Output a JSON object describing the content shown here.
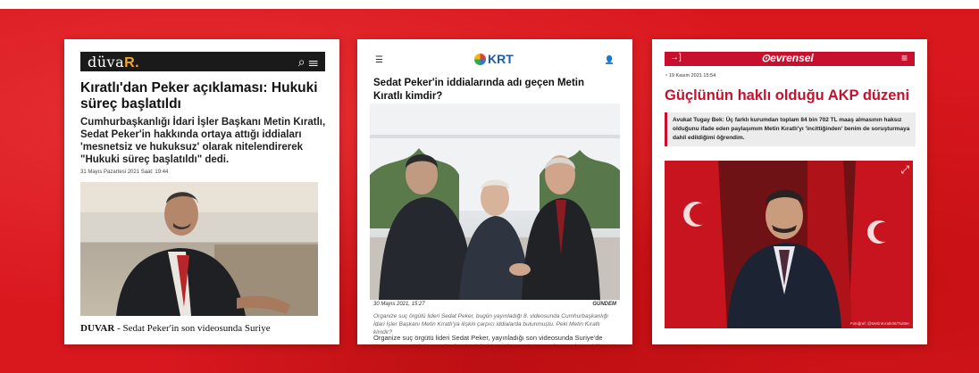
{
  "cards": [
    {
      "logo_main": "düva",
      "logo_accent": "R.",
      "title": "Kıratlı'dan Peker açıklaması: Hukuki süreç başlatıldı",
      "lead": "Cumhurbaşkanlığı İdari İşler Başkanı Metin Kıratlı, Sedat Peker'in hakkında ortaya attığı iddiaları 'mesnetsiz ve hukuksuz' olarak nitelendirerek \"Hukuki süreç başlatıldı\" dedi.",
      "date": "31 Mayıs Pazartesi 2021  Saat: 19:44",
      "caption_source": "DUVAR",
      "caption_text": " - Sedat Peker'in son videosunda Suriye",
      "icons": [
        "search-icon",
        "menu-icon"
      ]
    },
    {
      "logo": "KRT",
      "title": "Sedat Peker'in iddialarında adı geçen Metin Kıratlı kimdir?",
      "date": "30 Mayıs 2021, 15:27",
      "category": "GÜNDEM",
      "summary": "Organize suç örgütü lideri Sedat Peker, bugün yayınladığı 8. videosunda Cumhurbaşkanlığı İdari İşler Başkanı Metin Kıratlı'ya ilişkin çarpıcı iddialarda bulunmuştu. Peki Metin Kıratlı kimdir?",
      "body": "Organize suç örgütü lideri Sedat Peker, yayınladığı son videosunda Suriye'de ticaret yapmak için Cumhurbaşkanlığı İdari İşler Başkanı Metin Kıratlı'ya gidilmesi gerektiğini iddia etmişti.",
      "icons": [
        "menu-icon",
        "user-icon"
      ]
    },
    {
      "logo": "evrensel",
      "date": "19 Kasım 2021 15:54",
      "title": "Güçlünün haklı olduğu AKP düzeni",
      "quote": "Avukat Tugay Bek: Üç farklı kurumdan toplam 84 bin 702 TL maaş almasının haksız olduğunu ifade eden paylaşımım Metin Kıratlı'yı 'incittiğinden' benim de soruşturmaya dahil edildiğimi öğrendim.",
      "photo_credit": "Fotoğraf: @MetinKıratlı06/Twitter",
      "icons": [
        "login-icon",
        "menu-icon",
        "clock-icon",
        "expand-icon"
      ]
    }
  ],
  "colors": {
    "background_red": "#d9181e",
    "duvar_accent": "#f5a623",
    "krt_blue": "#1e5aa8",
    "evrensel_red": "#c8102e"
  }
}
